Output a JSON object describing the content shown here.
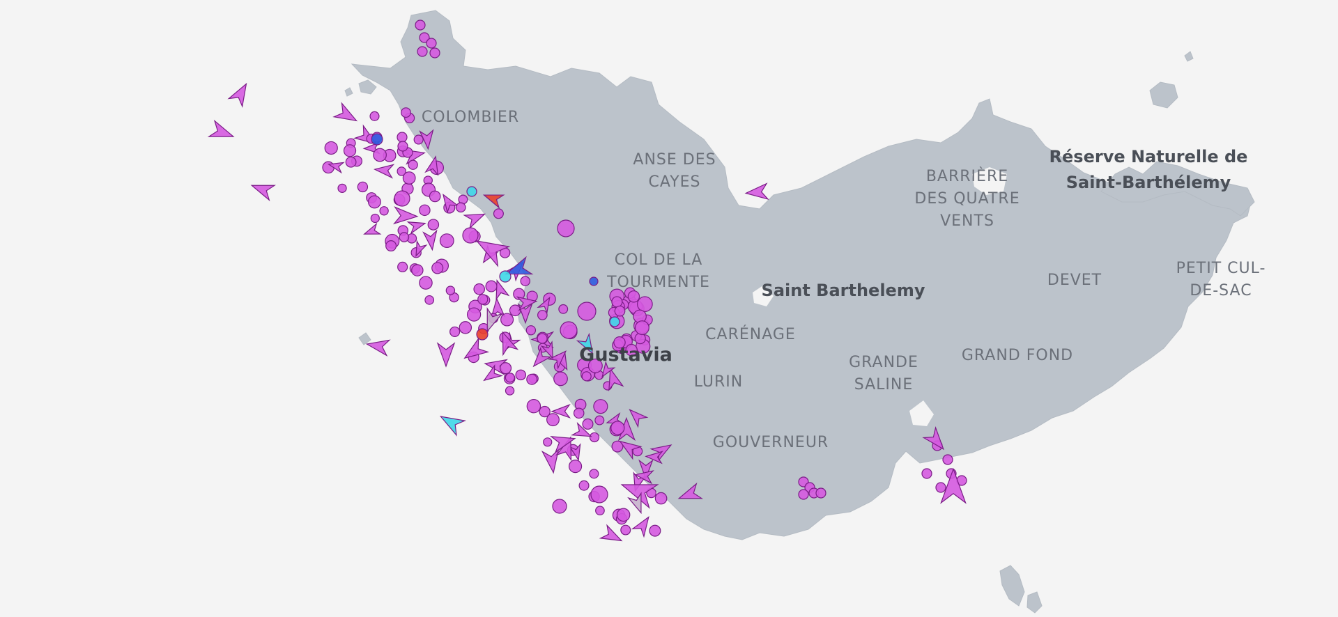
{
  "map": {
    "place_labels": {
      "colombier": "COLOMBIER",
      "anse_des_cayes_1": "ANSE DES",
      "anse_des_cayes_2": "CAYES",
      "barriere_1": "BARRIÈRE",
      "barriere_2": "DES QUATRE",
      "barriere_3": "VENTS",
      "reserve_1": "Réserve Naturelle de",
      "reserve_2": "Saint-Barthélemy",
      "col_1": "COL DE LA",
      "col_2": "TOURMENTE",
      "saint_barthelemy": "Saint Barthelemy",
      "devet": "DEVET",
      "petit_cul_1": "PETIT CUL-",
      "petit_cul_2": "DE-SAC",
      "carenage": "CARÉNAGE",
      "gustavia": "Gustavia",
      "lurin": "LURIN",
      "grande_saline_1": "GRANDE",
      "grande_saline_2": "SALINE",
      "grand_fond": "GRAND FOND",
      "gouverneur": "GOUVERNEUR"
    },
    "colors": {
      "water": "#f4f4f4",
      "land": "#bcc3cb",
      "vessel_pleasure": "#d55ae0",
      "vessel_passenger": "#2f5de0",
      "vessel_cargo": "#3fd7e8",
      "vessel_tanker": "#e8402a",
      "vessel_unknown": "#c6b3cc"
    }
  }
}
